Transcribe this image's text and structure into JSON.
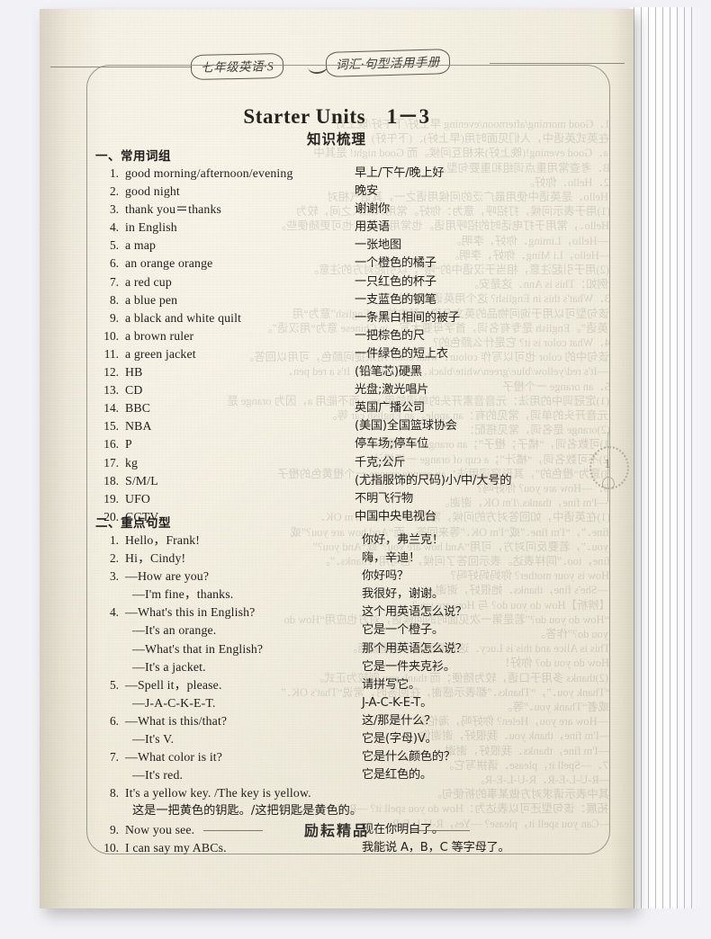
{
  "book": {
    "running_head_left": "七年级英语·S",
    "running_head_right": "词汇·句型活用手册",
    "footer_brand": "励耘精品",
    "page_number": "1"
  },
  "page": {
    "title": "Starter Units　1－3",
    "subtitle": "知识梳理"
  },
  "sections": [
    {
      "heading": "一、常用词组",
      "items": [
        {
          "num": "1.",
          "en": "good morning/afternoon/evening",
          "zh": "早上/下午/晚上好"
        },
        {
          "num": "2.",
          "en": "good night",
          "zh": "晚安"
        },
        {
          "num": "3.",
          "en": "thank you＝thanks",
          "zh": "谢谢你"
        },
        {
          "num": "4.",
          "en": "in English",
          "zh": "用英语"
        },
        {
          "num": "5.",
          "en": "a map",
          "zh": "一张地图"
        },
        {
          "num": "6.",
          "en": "an orange orange",
          "zh": "一个橙色的橘子"
        },
        {
          "num": "7.",
          "en": "a red cup",
          "zh": "一只红色的杯子"
        },
        {
          "num": "8.",
          "en": "a blue pen",
          "zh": "一支蓝色的钢笔"
        },
        {
          "num": "9.",
          "en": "a black and white quilt",
          "zh": "一条黑白相间的被子"
        },
        {
          "num": "10.",
          "en": "a brown ruler",
          "zh": "一把棕色的尺"
        },
        {
          "num": "11.",
          "en": "a green jacket",
          "zh": "一件绿色的短上衣"
        },
        {
          "num": "12.",
          "en": "HB",
          "zh": "(铅笔芯)硬黑"
        },
        {
          "num": "13.",
          "en": "CD",
          "zh": "光盘;激光唱片"
        },
        {
          "num": "14.",
          "en": "BBC",
          "zh": "英国广播公司"
        },
        {
          "num": "15.",
          "en": "NBA",
          "zh": "(美国)全国篮球协会"
        },
        {
          "num": "16.",
          "en": "P",
          "zh": "停车场;停车位"
        },
        {
          "num": "17.",
          "en": "kg",
          "zh": "千克;公斤"
        },
        {
          "num": "18.",
          "en": "S/M/L",
          "zh": "(尤指服饰的尺码)小/中/大号的"
        },
        {
          "num": "19.",
          "en": "UFO",
          "zh": "不明飞行物"
        },
        {
          "num": "20.",
          "en": "CCTV",
          "zh": "中国中央电视台"
        }
      ]
    },
    {
      "heading": "二、重点句型",
      "items": [
        {
          "num": "1.",
          "en": "Hello，Frank!",
          "zh": "你好，弗兰克！"
        },
        {
          "num": "2.",
          "en": "Hi，Cindy!",
          "zh": "嗨，辛迪！"
        },
        {
          "num": "3.",
          "en": "—How are you?",
          "zh": "你好吗？"
        },
        {
          "num": "",
          "en": "—I'm fine，thanks.",
          "zh": "我很好，谢谢。",
          "sub": true
        },
        {
          "num": "4.",
          "en": "—What's this in English?",
          "zh": "这个用英语怎么说？"
        },
        {
          "num": "",
          "en": "—It's an orange.",
          "zh": "它是一个橙子。",
          "sub": true
        },
        {
          "num": "",
          "en": "—What's that in English?",
          "zh": "那个用英语怎么说？",
          "sub": true
        },
        {
          "num": "",
          "en": "—It's a jacket.",
          "zh": "它是一件夹克衫。",
          "sub": true
        },
        {
          "num": "5.",
          "en": "—Spell it，please.",
          "zh": "请拼写它。"
        },
        {
          "num": "",
          "en": "—J-A-C-K-E-T.",
          "zh": "J-A-C-K-E-T。",
          "sub": true
        },
        {
          "num": "6.",
          "en": "—What is this/that?",
          "zh": "这/那是什么？"
        },
        {
          "num": "",
          "en": "—It's V.",
          "zh": "它是(字母)V。",
          "sub": true
        },
        {
          "num": "7.",
          "en": "—What color is it?",
          "zh": "它是什么颜色的？"
        },
        {
          "num": "",
          "en": "—It's red.",
          "zh": "它是红色的。",
          "sub": true
        },
        {
          "num": "8.",
          "en": "It's a yellow key. /The key is yellow.",
          "zh": ""
        },
        {
          "num": "",
          "en": "",
          "zh": "",
          "full": "这是一把黄色的钥匙。/这把钥匙是黄色的。"
        },
        {
          "num": "9.",
          "en": "Now you see.",
          "zh": "现在你明白了。"
        },
        {
          "num": "10.",
          "en": "I can say my ABCs.",
          "zh": "我能说 A，B，C 等字母了。"
        }
      ]
    }
  ],
  "bleed_lines": [
    "1．Good morning/afternoon/evening 早上好/下午好/晚上好",
    "在英式英语中，人们见面时用(早上好)、(下午好)",
    "a．Good evening!(晚上好)来相互问候。而 Good night! 是其中",
    "B．考查常用重点词组和重要句型。",
    "2．Hello．你好。",
    "Hello．是英语中使用最广泛的问候用语之一，其语气相对",
    "(1)用于表示问候，打招呼，意为：你好。常用人熟人之间，较为",
    "Hello．，常用于打电话时的招呼用语。也常用 hello，也可更随便些。",
    "—Hello，Liming．你好，李明。",
    "—Hello，Li Ming．你好，李明。",
    "(2)用于引起注意，相当于汉语中的“喂”，以引起对方的注意。",
    "例如：This is Ann．这是安。",
    "3．What's this in English? 这个用英语怎么说？",
    "该句型可以用于询问物品的英文名称，其中的“in English”意为“用",
    "英语”。English 是专有名词，首字母要大写。in Chinese 意为“用汉语”。",
    "4．What color is it? 它是什么颜色的？",
    "该句中的 color 也可以写作 colour．what color 用来提问颜色，可用以回答。",
    "—It's red/yellow/blue/green/white/black．也可以回答：It's a red pen．",
    "5．an orange 一个橙子",
    "(1)定冠词中的用法：元音音素开头的单词前用 an，而不能用 a，因为 orange 是",
    "元音开头的单词，常见的有：an apple，an English car 等。",
    "(2)orange 是名词，常见搭配：",
    "1)可数名词，“橘子；橙子”；an orange 一个橙子",
    "2)不可数名词，“橘汁”；a cup of orange 一杯橘汁",
    "3)意为“橙色的”，其形容词用法：an orange orange 一个橙黄色的橙子",
    "6．—How are you? 你好吗？",
    "—I'm fine，thanks./I'm OK，谢谢。",
    "(1)在英语中，如回答对方的问候，常用：I'm fine．/I'm OK．",
    "fine．”，“I'm fine．”或“I'm OK．”等来回答。而“And how are you?”或",
    "you．”，若要反问对方，可用“And how are you?”或“And you?”",
    "fine，too．”同样表达。表示回答了问候，也可用“Thanks．”。",
    "How is your mother? 你妈妈好吗？",
    "—She's fine，thanks．她很好，谢谢。",
    "【辨析】How do you do? 与 How are you?",
    "“How do you do?”若是第一次见面时的问候语，对方也应用“How do",
    "you do?”作答。",
    "This is Alice and this is Lucy．这是爱丽丝，这是露西。",
    "How do you do? 你好！",
    "(2)thanks 多用于口语，较为随便；而 thank you 则较为正式。",
    "“Thank you．”，“Thanks．”都表示感谢，在回答时，常说“That's OK．”",
    "或者“Thank you．”等。",
    "—How are you，Helen? 你好吗，海伦？",
    "—I'm fine，thank you．我很好，谢谢你。",
    "—I'm fine，thanks．我很好，谢谢。",
    "7．—Spell it，please．请拼写它。",
    "—R-U-L-E-R．R-U-L-E-R。",
    "其中表示请求对方做某事的祈使句。",
    "拓展：该句型还可以表达为：How do you spell it? —R-U-L-E-R．",
    "—Can you spell it，please? —Yes，R-U-L-E-R."
  ]
}
